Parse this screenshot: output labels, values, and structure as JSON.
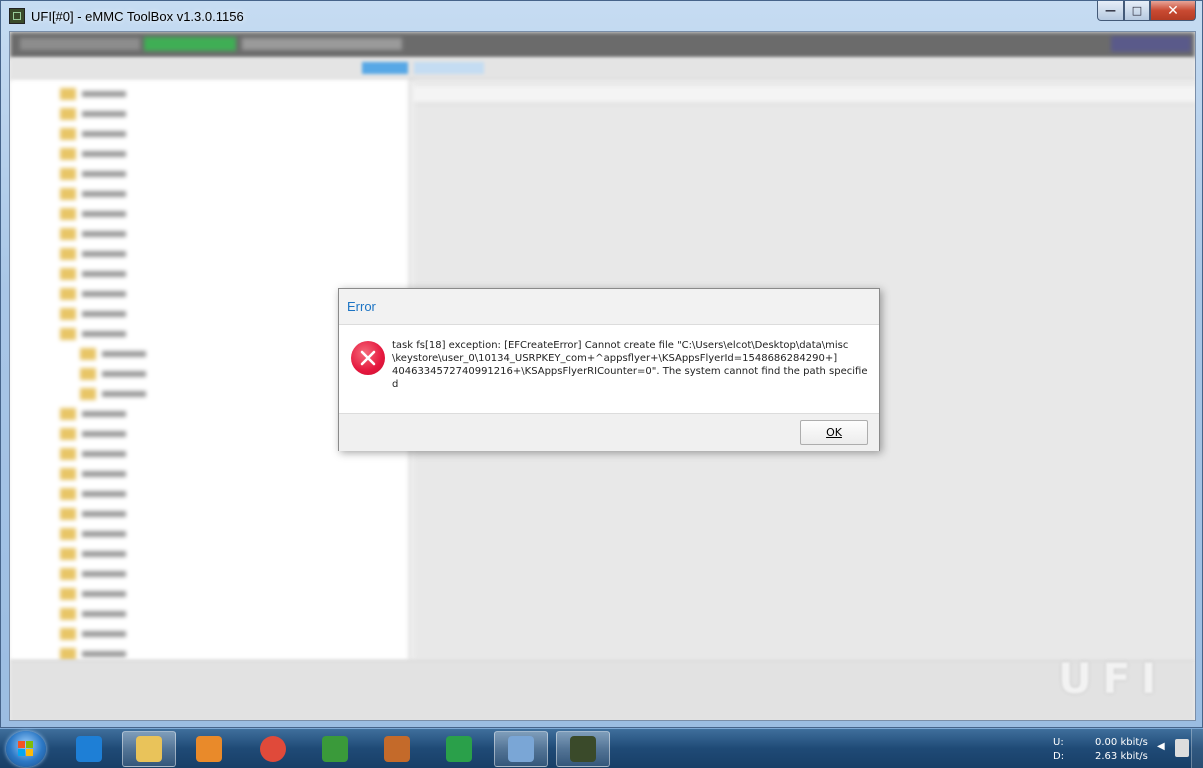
{
  "window": {
    "title": "UFI[#0] - eMMC ToolBox v1.3.0.1156",
    "controls": {
      "minimize": "—",
      "maximize": "□",
      "close": "✕"
    }
  },
  "watermark": "UFI",
  "dialog": {
    "title": "Error",
    "message": "task fs[18] exception: [EFCreateError] Cannot create file \"C:\\Users\\elcot\\Desktop\\data\\misc\n\\keystore\\user_0\\10134_USRPKEY_com+^appsflyer+\\KSAppsFlyerId=1548686284290+]\n4046334572740991216+\\KSAppsFlyerRICounter=0\". The system cannot find the path specified",
    "ok_label": "OK",
    "icon": "error-icon"
  },
  "taskbar": {
    "items": [
      {
        "name": "internet-explorer",
        "color": "#1e7fd6"
      },
      {
        "name": "file-explorer",
        "color": "#e9c35a"
      },
      {
        "name": "media-player",
        "color": "#e98a2a"
      },
      {
        "name": "chrome",
        "color": "#e04a3a"
      },
      {
        "name": "network-tool",
        "color": "#3a9a3a"
      },
      {
        "name": "photo-app",
        "color": "#c46a2a"
      },
      {
        "name": "paint-app",
        "color": "#2aa04a"
      },
      {
        "name": "control-panel",
        "color": "#7aa6d6"
      },
      {
        "name": "ufi-toolbox",
        "color": "#3a4a2a"
      }
    ],
    "tray": {
      "upload_label": "U:",
      "upload_value": "0.00 kbit/s",
      "download_label": "D:",
      "download_value": "2.63 kbit/s"
    }
  }
}
